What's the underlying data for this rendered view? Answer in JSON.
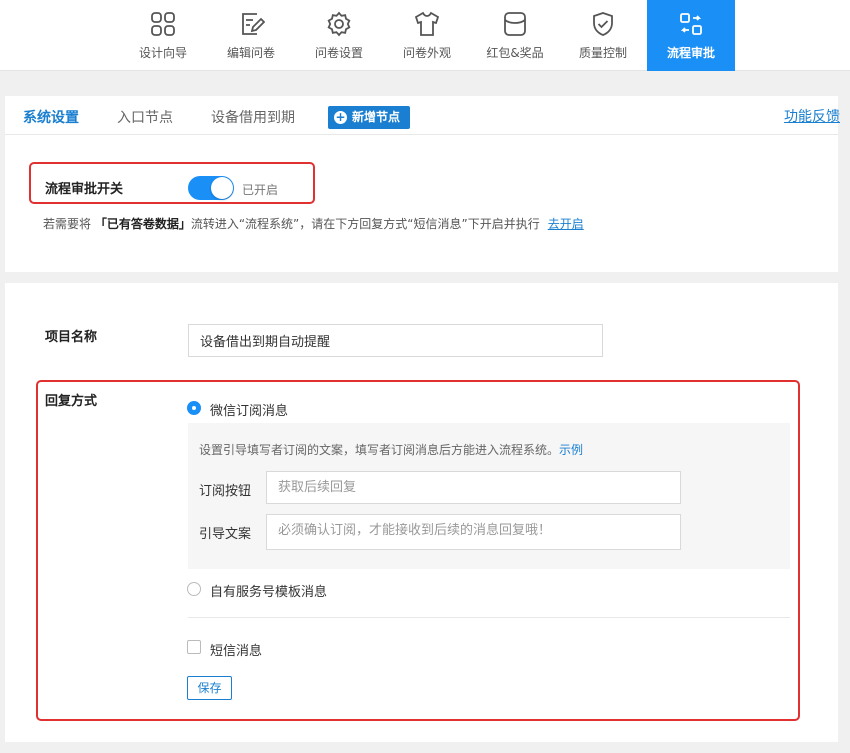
{
  "nav": {
    "items": [
      {
        "label": "设计向导",
        "icon": "grid-icon"
      },
      {
        "label": "编辑问卷",
        "icon": "edit-icon"
      },
      {
        "label": "问卷设置",
        "icon": "gear-icon"
      },
      {
        "label": "问卷外观",
        "icon": "shirt-icon"
      },
      {
        "label": "红包&奖品",
        "icon": "red-envelope-icon"
      },
      {
        "label": "质量控制",
        "icon": "shield-check-icon"
      },
      {
        "label": "流程审批",
        "icon": "workflow-icon"
      }
    ],
    "active_index": 6
  },
  "tabs": {
    "items": [
      "系统设置",
      "入口节点",
      "设备借用到期"
    ],
    "active_index": 0,
    "add_node_label": "新增节点",
    "feedback_label": "功能反馈"
  },
  "approval_switch": {
    "label": "流程审批开关",
    "enabled": true,
    "status": "已开启"
  },
  "hint": {
    "prefix": "若需要将 ",
    "highlight": "「已有答卷数据」",
    "suffix": "流转进入“流程系统”，请在下方回复方式“短信消息”下开启并执行",
    "link": "去开启"
  },
  "form": {
    "project_name_label": "项目名称",
    "project_name_value": "设备借出到期自动提醒",
    "reply_label": "回复方式",
    "options": {
      "wechat": {
        "label": "微信订阅消息",
        "selected": true
      },
      "service": {
        "label": "自有服务号模板消息",
        "selected": false
      },
      "sms": {
        "label": "短信消息",
        "checked": false
      }
    },
    "wechat_panel": {
      "hint": "设置引导填写者订阅的文案，填写者订阅消息后方能进入流程系统。",
      "example_link": "示例",
      "subscribe_button_label": "订阅按钮",
      "subscribe_button_placeholder": "获取后续回复",
      "guide_text_label": "引导文案",
      "guide_text_placeholder": "必须确认订阅，才能接收到后续的消息回复哦！"
    },
    "save_label": "保存"
  },
  "colors": {
    "primary": "#1a8ff5",
    "link": "#1a7fd0",
    "highlight_border": "#e03030"
  }
}
